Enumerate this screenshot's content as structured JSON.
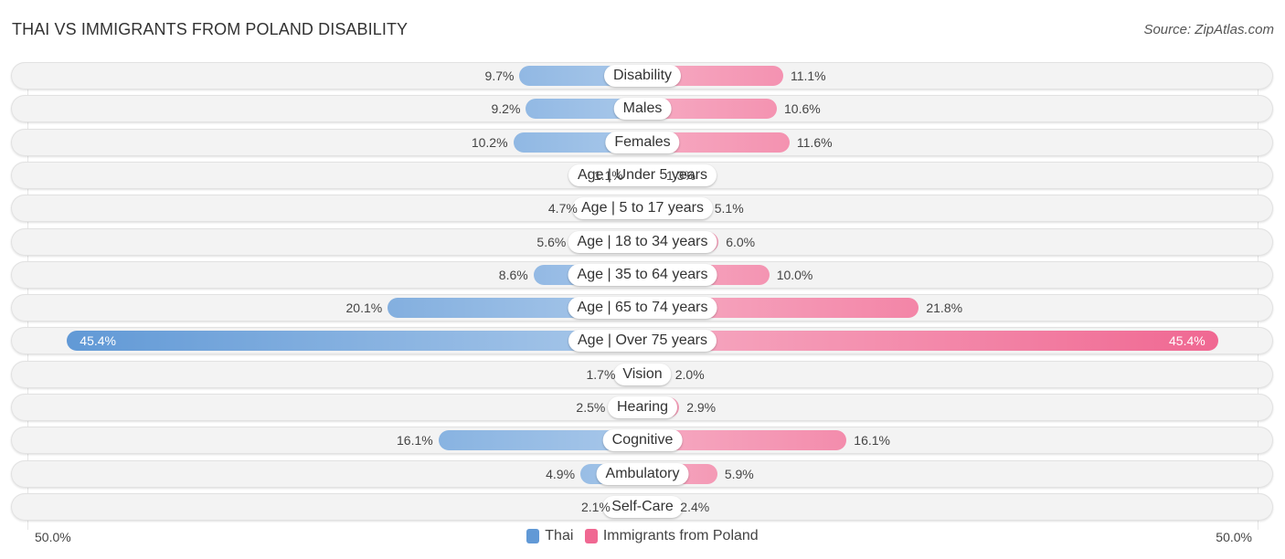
{
  "title": "THAI VS IMMIGRANTS FROM POLAND DISABILITY",
  "source": "Source: ZipAtlas.com",
  "colors": {
    "thai_light": "#a9c8ea",
    "thai_dark": "#6199d6",
    "poland_light": "#f6aac2",
    "poland_dark": "#f06892"
  },
  "chart_data": {
    "type": "bar",
    "orientation": "horizontal-diverging",
    "title": "THAI VS IMMIGRANTS FROM POLAND DISABILITY",
    "categories": [
      "Disability",
      "Males",
      "Females",
      "Age | Under 5 years",
      "Age | 5 to 17 years",
      "Age | 18 to 34 years",
      "Age | 35 to 64 years",
      "Age | 65 to 74 years",
      "Age | Over 75 years",
      "Vision",
      "Hearing",
      "Cognitive",
      "Ambulatory",
      "Self-Care"
    ],
    "series": [
      {
        "name": "Thai",
        "side": "left",
        "values": [
          9.7,
          9.2,
          10.2,
          1.1,
          4.7,
          5.6,
          8.6,
          20.1,
          45.4,
          1.7,
          2.5,
          16.1,
          4.9,
          2.1
        ],
        "labels": [
          "9.7%",
          "9.2%",
          "10.2%",
          "1.1%",
          "4.7%",
          "5.6%",
          "8.6%",
          "20.1%",
          "45.4%",
          "1.7%",
          "2.5%",
          "16.1%",
          "4.9%",
          "2.1%"
        ]
      },
      {
        "name": "Immigrants from Poland",
        "side": "right",
        "values": [
          11.1,
          10.6,
          11.6,
          1.3,
          5.1,
          6.0,
          10.0,
          21.8,
          45.4,
          2.0,
          2.9,
          16.1,
          5.9,
          2.4
        ],
        "labels": [
          "11.1%",
          "10.6%",
          "11.6%",
          "1.3%",
          "5.1%",
          "6.0%",
          "10.0%",
          "21.8%",
          "45.4%",
          "2.0%",
          "2.9%",
          "16.1%",
          "5.9%",
          "2.4%"
        ]
      }
    ],
    "xlim": [
      -50,
      50
    ],
    "axis_labels": {
      "left": "50.0%",
      "right": "50.0%"
    },
    "legend": [
      "Thai",
      "Immigrants from Poland"
    ],
    "legend_position": "bottom-center",
    "unit": "%"
  }
}
